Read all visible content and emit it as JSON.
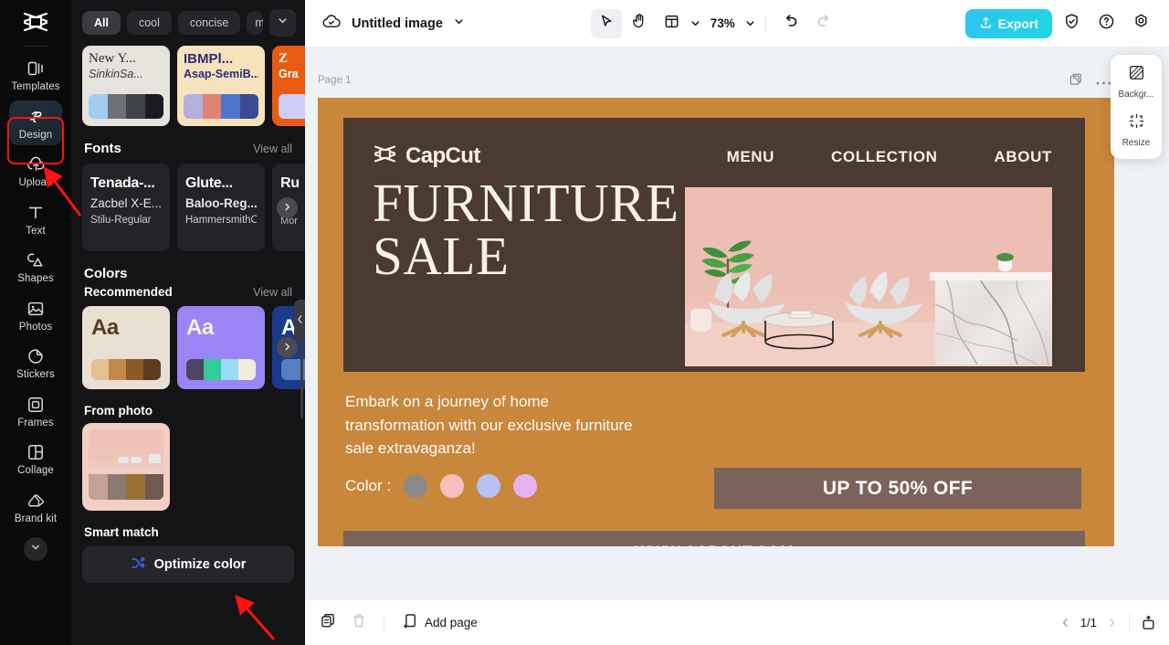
{
  "rail": {
    "logo": "capcut-logo",
    "items": [
      {
        "label": "Templates",
        "icon": "templates-icon",
        "active": false
      },
      {
        "label": "Design",
        "icon": "design-icon",
        "active": true
      },
      {
        "label": "Upload",
        "icon": "upload-icon",
        "active": false
      },
      {
        "label": "Text",
        "icon": "text-icon",
        "active": false
      },
      {
        "label": "Shapes",
        "icon": "shapes-icon",
        "active": false
      },
      {
        "label": "Photos",
        "icon": "photos-icon",
        "active": false
      },
      {
        "label": "Stickers",
        "icon": "stickers-icon",
        "active": false
      },
      {
        "label": "Frames",
        "icon": "frames-icon",
        "active": false
      },
      {
        "label": "Collage",
        "icon": "collage-icon",
        "active": false
      },
      {
        "label": "Brand kit",
        "icon": "brandkit-icon",
        "active": false
      }
    ],
    "more_icon": "chevron-down-icon",
    "highlight_color": "#ff1212"
  },
  "panel": {
    "chips": [
      {
        "label": "All",
        "selected": true
      },
      {
        "label": "cool",
        "selected": false
      },
      {
        "label": "concise",
        "selected": false
      },
      {
        "label": "modern",
        "selected": false
      }
    ],
    "chip_expand_icon": "chevron-down-icon",
    "templates": [
      {
        "title": "New Y...",
        "subtitle": "SinkinSa...",
        "bg": "#e6e2dc",
        "title_color": "#2b2b2b",
        "sub_color": "#3a3a3a",
        "swatches": [
          "#9fcdf0",
          "#6d7076",
          "#3f4246",
          "#191b1e"
        ]
      },
      {
        "title": "IBMPl...",
        "subtitle": "Asap-SemiB...",
        "bg": "#f6e3bb",
        "title_color": "#2d2a7a",
        "sub_color": "#2d2a7a",
        "swatches": [
          "#b3b0de",
          "#e08273",
          "#4f76cf",
          "#3b4a91"
        ]
      },
      {
        "title": "Z",
        "subtitle": "Gra",
        "bg": "#ea5b12",
        "title_color": "#ffffff",
        "sub_color": "#ffffff",
        "swatches": [
          "#cdcdf5",
          "#cdcdf5",
          "#cdcdf5",
          "#cdcdf5"
        ]
      }
    ],
    "fonts_section": {
      "title": "Fonts",
      "view_all": "View all"
    },
    "fonts": [
      {
        "line1": "Tenada-...",
        "line2": "Zacbel X-E...",
        "line3": "Stilu-Regular"
      },
      {
        "line1": "Glute...",
        "line2": "Baloo-Reg...",
        "line3": "HammersmithOn..."
      },
      {
        "line1": "Ru",
        "line2": "",
        "line3": "Mor"
      }
    ],
    "fonts_next_icon": "chevron-right-icon",
    "colors_section": {
      "title": "Colors",
      "sub": "Recommended",
      "view_all": "View all"
    },
    "palettes": [
      {
        "aa": "Aa",
        "bg": "#e9dfd3",
        "aa_color": "#5b3a22",
        "swatches": [
          "#e2c092",
          "#c5874a",
          "#8b5a2b",
          "#5a3a20"
        ]
      },
      {
        "aa": "Aa",
        "bg": "#9b85f5",
        "aa_color": "#f6f1e0",
        "swatches": [
          "#4b4566",
          "#32cd96",
          "#99dcf7",
          "#f2ecdc"
        ]
      },
      {
        "aa": "A",
        "bg": "#1b3a8c",
        "aa_color": "#ffffff",
        "swatches": [
          "#5480bd",
          "#5480bd",
          "#5480bd",
          "#5480bd"
        ]
      }
    ],
    "palettes_next_icon": "chevron-right-icon",
    "from_photo_label": "From photo",
    "from_photo_swatches": [
      "#c4a096",
      "#8b7a71",
      "#9a7034",
      "#6f5a50"
    ],
    "smart_match_label": "Smart match",
    "optimize_button": {
      "label": "Optimize color",
      "icon": "shuffle-icon",
      "icon_color": "#2d6cff"
    },
    "collapse_icon": "chevron-left-icon"
  },
  "topbar": {
    "cloud_icon": "cloud-saved-icon",
    "title": "Untitled image",
    "title_caret": "chevron-down-icon",
    "tools": [
      {
        "name": "select-tool",
        "icon": "cursor-icon",
        "active": true
      },
      {
        "name": "hand-tool",
        "icon": "hand-icon",
        "active": false
      },
      {
        "name": "layout-tool",
        "icon": "layout-icon",
        "active": false
      }
    ],
    "layout_caret": "chevron-down-icon",
    "zoom_level": "73%",
    "zoom_caret": "chevron-down-icon",
    "undo_icon": "undo-icon",
    "redo_icon": "redo-icon",
    "export_label": "Export",
    "export_icon": "upload-arrow-icon",
    "export_color_start": "#2ec5f0",
    "export_color_end": "#1fd6e0",
    "shield_icon": "shield-check-icon",
    "help_icon": "question-circle-icon",
    "settings_icon": "gear-icon"
  },
  "canvas": {
    "page_label": "Page 1",
    "duplicate_icon": "duplicate-page-icon",
    "more_icon": "more-horizontal-icon",
    "float_panel": [
      {
        "label": "Backgr...",
        "icon": "background-icon"
      },
      {
        "label": "Resize",
        "icon": "resize-icon"
      }
    ]
  },
  "design": {
    "bg_color": "#c8873a",
    "hero_color": "#4a3a31",
    "accent_color": "#7a635a",
    "brand": "CapCut",
    "brand_icon": "capcut-logo",
    "nav": [
      "MENU",
      "COLLECTION",
      "ABOUT"
    ],
    "headline_line1": "FURNITURE",
    "headline_line2": "SALE",
    "description": "Embark on a journey of home transformation with our exclusive furniture sale extravaganza!",
    "color_label": "Color :",
    "color_dots": [
      "#8d8988",
      "#f7bfbc",
      "#b8c0f4",
      "#e7b0f0"
    ],
    "offer_text": "UP TO 50% OFF",
    "footer_text": "WWW.CAPCUT.COM"
  },
  "bottombar": {
    "duplicate_icon": "duplicate-icon",
    "delete_icon": "trash-icon",
    "add_page_label": "Add page",
    "add_page_icon": "add-page-icon",
    "prev_icon": "chevron-left-icon",
    "page_indicator": "1/1",
    "next_icon": "chevron-right-icon",
    "collapse_icon": "collapse-panel-icon"
  }
}
